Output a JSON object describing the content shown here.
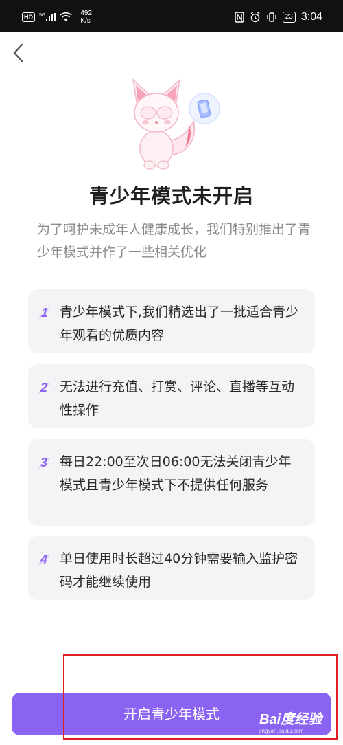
{
  "status_bar": {
    "hd": "HD",
    "signal": "5G",
    "speed_value": "492",
    "speed_unit": "K/s",
    "battery": "23",
    "time": "3:04"
  },
  "nav": {
    "back_icon": "chevron-left-icon"
  },
  "illustration": {
    "icon": "fox-mascot-icon"
  },
  "title": "青少年模式未开启",
  "subtitle": "为了呵护未成年人健康成长，我们特别推出了青少年模式并作了一些相关优化",
  "rules": [
    {
      "num": "1",
      "text": "青少年模式下,我们精选出了一批适合青少年观看的优质内容"
    },
    {
      "num": "2",
      "text": "无法进行充值、打赏、评论、直播等互动性操作"
    },
    {
      "num": "3",
      "text": "每日22:00至次日06:00无法关闭青少年模式且青少年模式下不提供任何服务"
    },
    {
      "num": "4",
      "text": "单日使用时长超过40分钟需要输入监护密码才能继续使用"
    }
  ],
  "cta": {
    "label": "开启青少年模式"
  },
  "watermark": {
    "brand": "Bai度经验",
    "url": "jingyan.baidu.com"
  },
  "colors": {
    "accent": "#8b63f2",
    "card_bg": "#f4f4f6",
    "annotation_red": "#e02020",
    "status_bar_bg": "#111111"
  }
}
